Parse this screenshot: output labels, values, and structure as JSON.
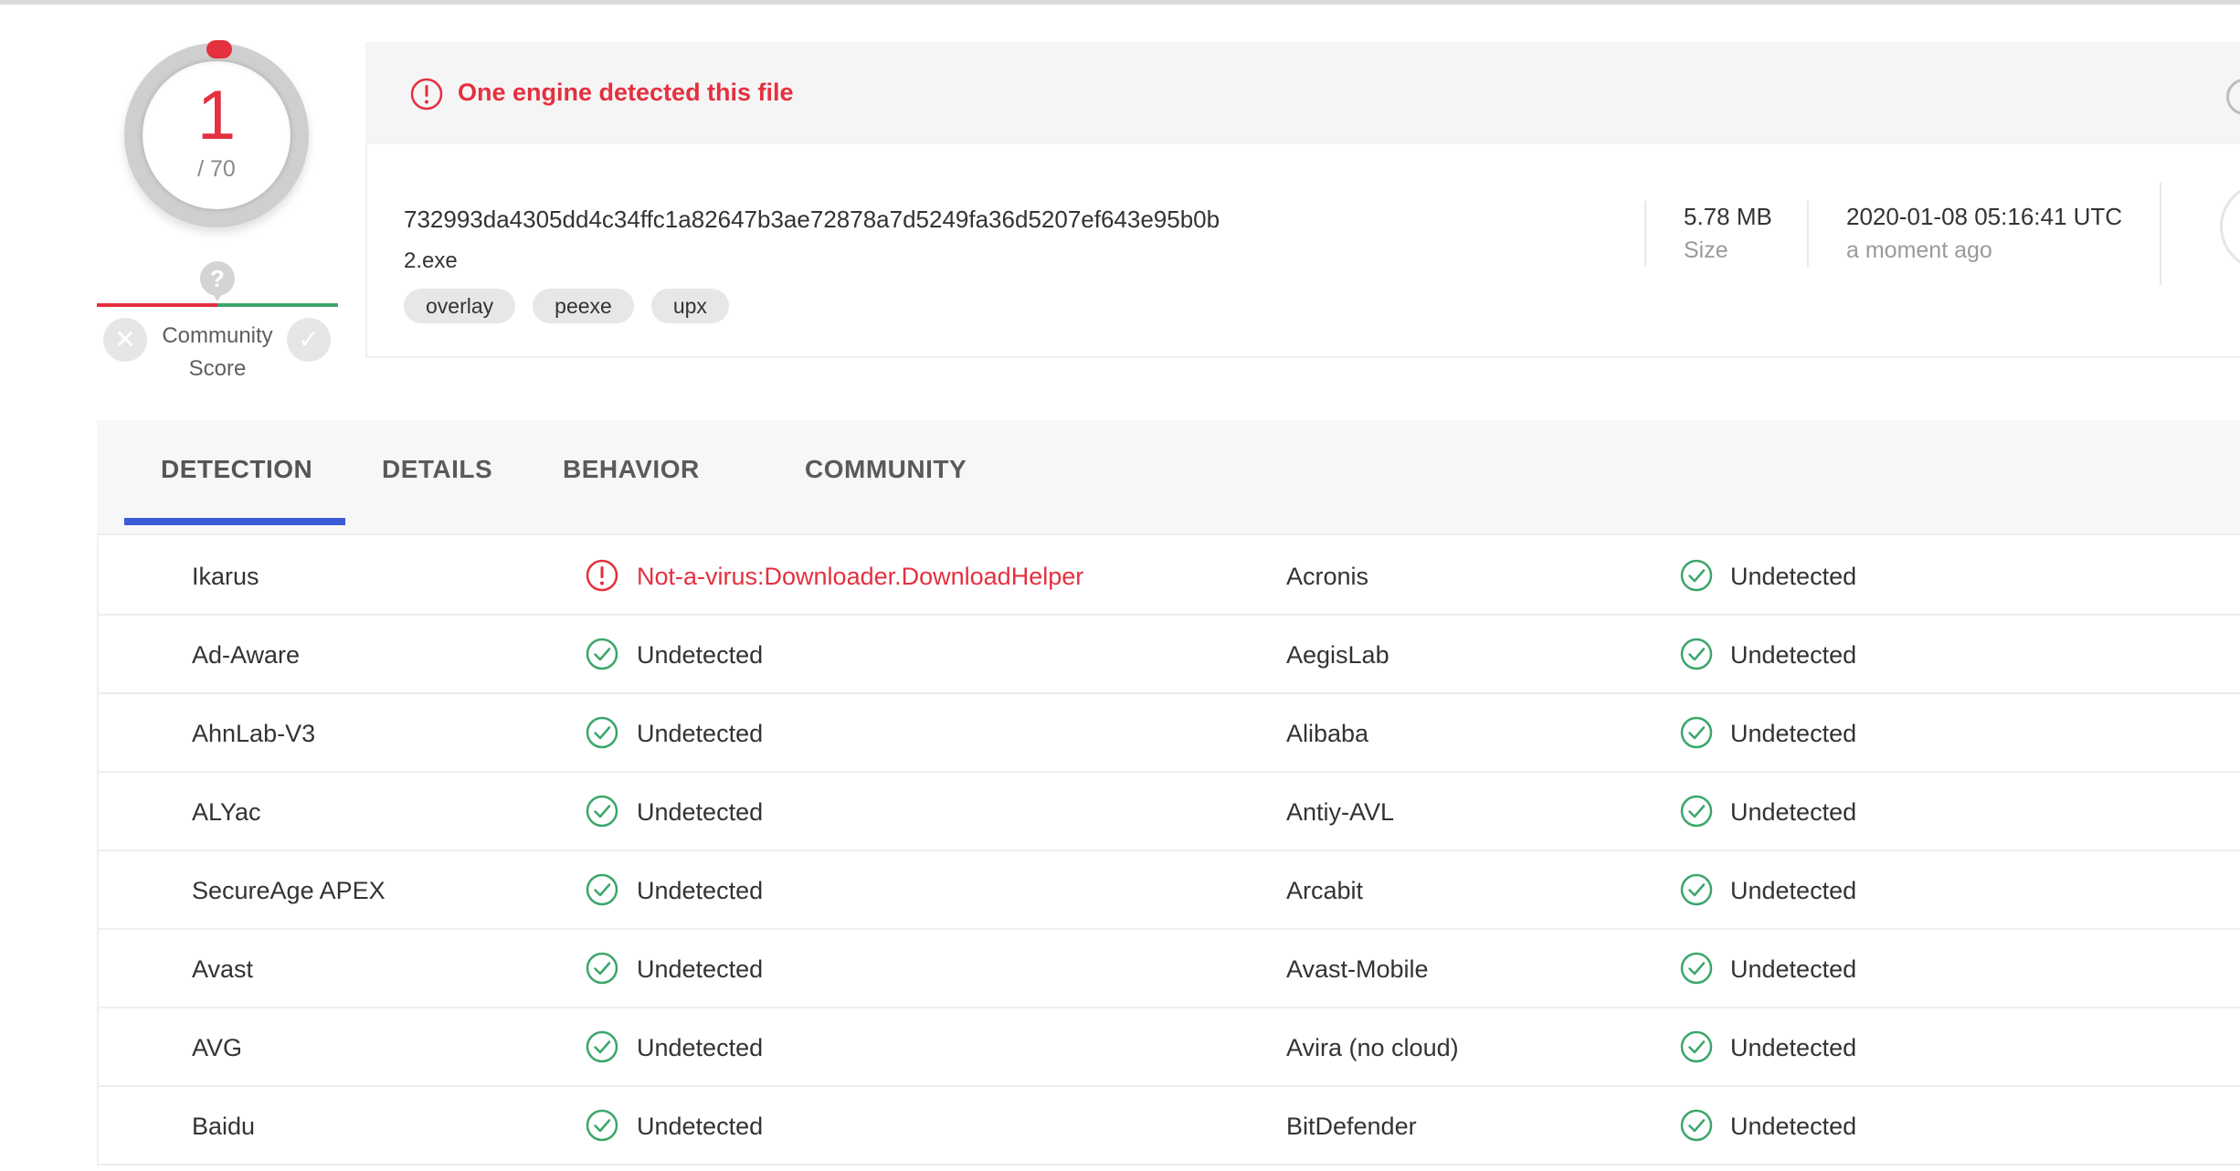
{
  "score": {
    "detected": "1",
    "total": "/ 70"
  },
  "community": {
    "question": "?",
    "label_line1": "Community",
    "label_line2": "Score"
  },
  "alert": {
    "text": "One engine detected this file"
  },
  "file": {
    "hash": "732993da4305dd4c34ffc1a82647b3ae72878a7d5249fa36d5207ef643e95b0b",
    "name": "2.exe",
    "tags": [
      "overlay",
      "peexe",
      "upx"
    ],
    "size_value": "5.78 MB",
    "size_label": "Size",
    "date_value": "2020-01-08 05:16:41 UTC",
    "date_label": "a moment ago"
  },
  "tabs": [
    {
      "label": "DETECTION",
      "active": true
    },
    {
      "label": "DETAILS",
      "active": false
    },
    {
      "label": "BEHAVIOR",
      "active": false
    },
    {
      "label": "COMMUNITY",
      "active": false
    }
  ],
  "colors": {
    "malicious": "#e4303f",
    "clean": "#3ca66a",
    "accent": "#3b5bdb"
  },
  "detections": [
    {
      "left": {
        "engine": "Ikarus",
        "result": "Not-a-virus:Downloader.DownloadHelper",
        "status": "detected"
      },
      "right": {
        "engine": "Acronis",
        "result": "Undetected",
        "status": "clean"
      }
    },
    {
      "left": {
        "engine": "Ad-Aware",
        "result": "Undetected",
        "status": "clean"
      },
      "right": {
        "engine": "AegisLab",
        "result": "Undetected",
        "status": "clean"
      }
    },
    {
      "left": {
        "engine": "AhnLab-V3",
        "result": "Undetected",
        "status": "clean"
      },
      "right": {
        "engine": "Alibaba",
        "result": "Undetected",
        "status": "clean"
      }
    },
    {
      "left": {
        "engine": "ALYac",
        "result": "Undetected",
        "status": "clean"
      },
      "right": {
        "engine": "Antiy-AVL",
        "result": "Undetected",
        "status": "clean"
      }
    },
    {
      "left": {
        "engine": "SecureAge APEX",
        "result": "Undetected",
        "status": "clean"
      },
      "right": {
        "engine": "Arcabit",
        "result": "Undetected",
        "status": "clean"
      }
    },
    {
      "left": {
        "engine": "Avast",
        "result": "Undetected",
        "status": "clean"
      },
      "right": {
        "engine": "Avast-Mobile",
        "result": "Undetected",
        "status": "clean"
      }
    },
    {
      "left": {
        "engine": "AVG",
        "result": "Undetected",
        "status": "clean"
      },
      "right": {
        "engine": "Avira (no cloud)",
        "result": "Undetected",
        "status": "clean"
      }
    },
    {
      "left": {
        "engine": "Baidu",
        "result": "Undetected",
        "status": "clean"
      },
      "right": {
        "engine": "BitDefender",
        "result": "Undetected",
        "status": "clean"
      }
    }
  ]
}
